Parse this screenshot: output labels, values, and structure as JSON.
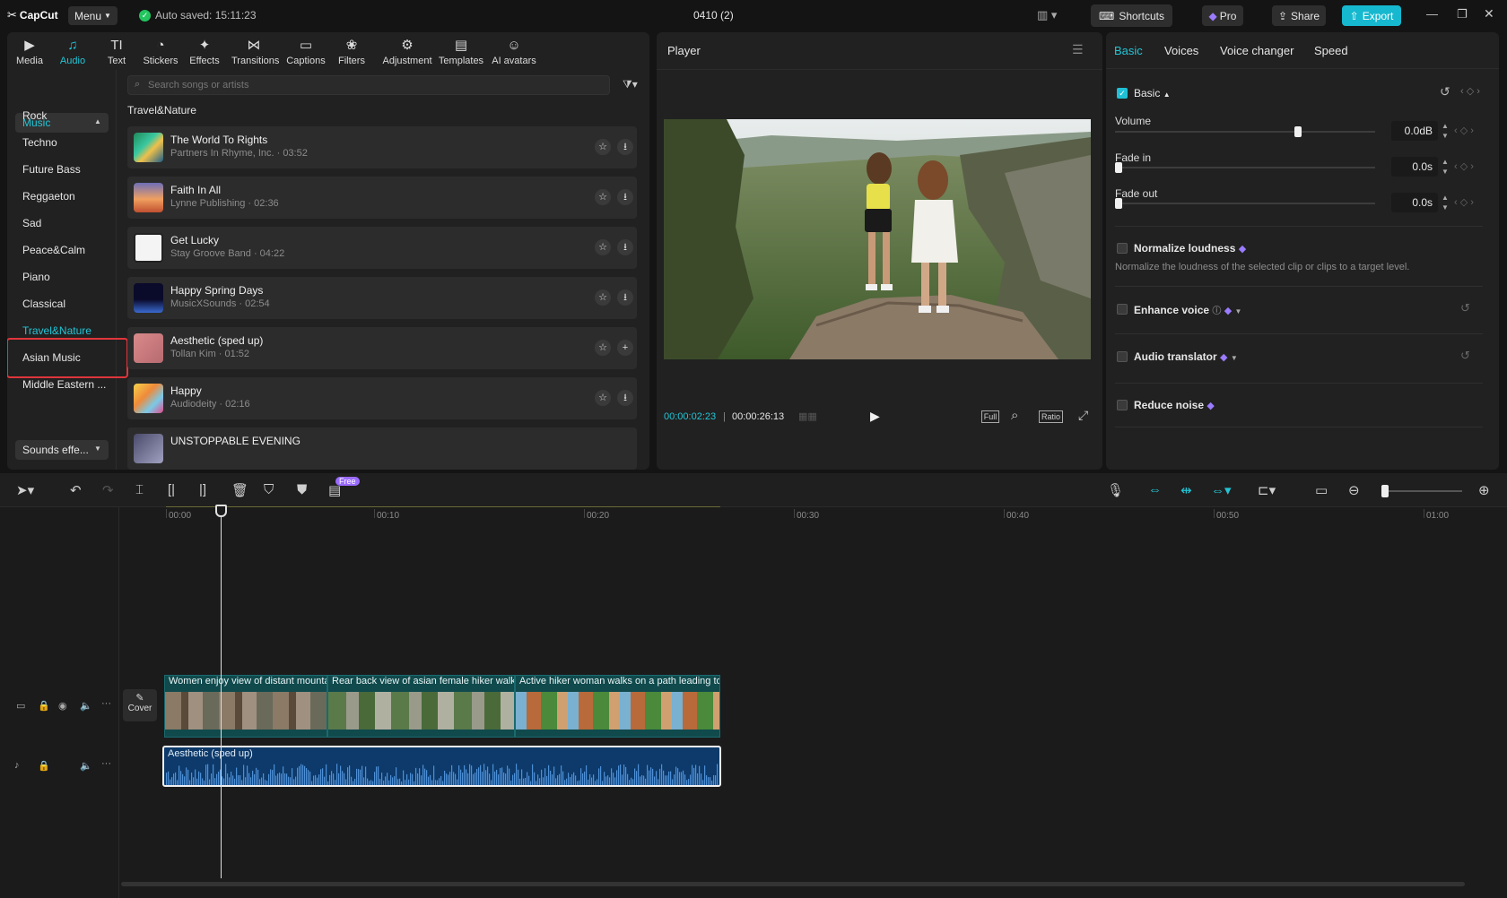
{
  "app": {
    "logo": "CapCut",
    "menu_label": "Menu",
    "autosave": "Auto saved: 15:11:23",
    "project_title": "0410 (2)",
    "shortcuts_label": "Shortcuts",
    "pro_label": "Pro",
    "share_label": "Share",
    "export_label": "Export"
  },
  "toolbar": {
    "items": [
      {
        "label": "Media",
        "icon": "media-icon"
      },
      {
        "label": "Audio",
        "icon": "audio-icon"
      },
      {
        "label": "Text",
        "icon": "text-icon"
      },
      {
        "label": "Stickers",
        "icon": "stickers-icon"
      },
      {
        "label": "Effects",
        "icon": "effects-icon"
      },
      {
        "label": "Transitions",
        "icon": "transitions-icon"
      },
      {
        "label": "Captions",
        "icon": "captions-icon"
      },
      {
        "label": "Filters",
        "icon": "filters-icon"
      },
      {
        "label": "Adjustment",
        "icon": "adjustment-icon"
      },
      {
        "label": "Templates",
        "icon": "templates-icon"
      },
      {
        "label": "AI avatars",
        "icon": "ai-avatars-icon"
      }
    ],
    "active_index": 1
  },
  "sidebar": {
    "music_label": "Music",
    "categories": [
      "Rock",
      "Techno",
      "Future Bass",
      "Reggaeton",
      "Sad",
      "Peace&Calm",
      "Piano",
      "Classical",
      "Travel&Nature",
      "Asian Music",
      "Middle Eastern ..."
    ],
    "selected": "Travel&Nature",
    "sounds_label": "Sounds effe..."
  },
  "search": {
    "placeholder": "Search songs or artists"
  },
  "music_list": {
    "heading": "Travel&Nature",
    "tracks": [
      {
        "name": "The World To Rights",
        "meta": "Partners In Rhyme, Inc. · 03:52",
        "action": "download"
      },
      {
        "name": "Faith In All",
        "meta": "Lynne Publishing · 02:36",
        "action": "download"
      },
      {
        "name": "Get Lucky",
        "meta": "Stay Groove Band · 04:22",
        "action": "download"
      },
      {
        "name": "Happy Spring Days",
        "meta": "MusicXSounds · 02:54",
        "action": "download"
      },
      {
        "name": "Aesthetic (sped up)",
        "meta": "Tollan Kim · 01:52",
        "action": "add"
      },
      {
        "name": "Happy",
        "meta": "Audiodeity · 02:16",
        "action": "download"
      },
      {
        "name": "UNSTOPPABLE EVENING",
        "meta": "",
        "action": "download"
      }
    ]
  },
  "player": {
    "title": "Player",
    "current_time": "00:00:02:23",
    "total_time": "00:00:26:13",
    "full_label": "Full",
    "ratio_label": "Ratio"
  },
  "properties": {
    "tabs": [
      "Basic",
      "Voices",
      "Voice changer",
      "Speed"
    ],
    "active_tab": "Basic",
    "basic_label": "Basic",
    "volume": {
      "label": "Volume",
      "value": "0.0dB",
      "level": 0.69
    },
    "fade_in": {
      "label": "Fade in",
      "value": "0.0s",
      "level": 0
    },
    "fade_out": {
      "label": "Fade out",
      "value": "0.0s",
      "level": 0
    },
    "normalize": {
      "label": "Normalize loudness",
      "desc": "Normalize the loudness of the selected clip or clips to a target level."
    },
    "enhance": {
      "label": "Enhance voice"
    },
    "translator": {
      "label": "Audio translator"
    },
    "reduce_noise": {
      "label": "Reduce noise"
    }
  },
  "timeline": {
    "free_badge": "Free",
    "ruler": [
      "00:00",
      "00:10",
      "00:20",
      "00:30",
      "00:40",
      "00:50",
      "01:00"
    ],
    "cover_label": "Cover",
    "video_clips": [
      {
        "label": "Women enjoy view of distant mountains"
      },
      {
        "label": "Rear back view of asian female hiker walking"
      },
      {
        "label": "Active hiker woman walks on a path leading to t"
      }
    ],
    "audio_clip": {
      "label": "Aesthetic (sped up)"
    }
  },
  "colors": {
    "accent": "#22c5d6",
    "selection": "#e0353b",
    "pro_gem": "#9b7bff"
  }
}
